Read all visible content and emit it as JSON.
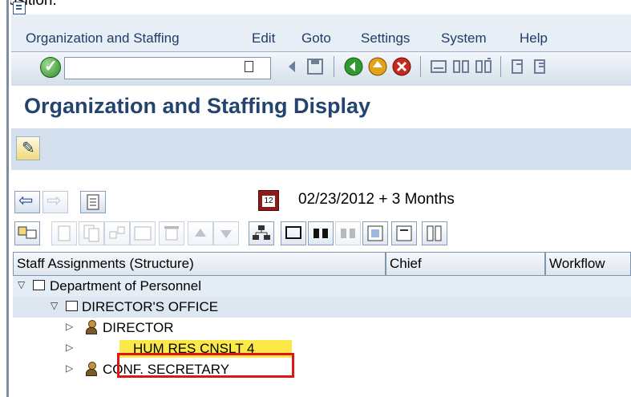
{
  "clipped_caption": "position.",
  "menu": {
    "items": [
      {
        "label": "Organization and Staffing"
      },
      {
        "label": "Edit"
      },
      {
        "label": "Goto"
      },
      {
        "label": "Settings"
      },
      {
        "label": "System"
      },
      {
        "label": "Help"
      }
    ]
  },
  "toolbar": {
    "command_field_value": "",
    "icons": [
      "enter-icon",
      "back-icon",
      "save-icon",
      "exit-icon",
      "cancel-icon",
      "print-icon",
      "find-icon",
      "find-next-icon",
      "first-page-icon",
      "previous-page-icon"
    ]
  },
  "title": "Organization and Staffing Display",
  "date": {
    "text": "02/23/2012  + 3 Months"
  },
  "grid": {
    "columns": [
      {
        "label": "Staff Assignments (Structure)"
      },
      {
        "label": "Chief"
      },
      {
        "label": "Workflow"
      }
    ],
    "rows": [
      {
        "label": "Department of Personnel",
        "type": "org",
        "expanded": true
      },
      {
        "label": "DIRECTOR'S OFFICE",
        "type": "org",
        "expanded": true
      },
      {
        "label": "DIRECTOR",
        "type": "position",
        "expanded": false
      },
      {
        "label": "HUM RES CNSLT 4",
        "type": "position",
        "expanded": false,
        "selected": true
      },
      {
        "label": "CONF. SECRETARY",
        "type": "position",
        "expanded": false
      }
    ]
  },
  "colors": {
    "title": "#23446e",
    "menu_text": "#1f3d66",
    "highlight_border": "#e01515",
    "selection_fill": "#fbe94a"
  }
}
